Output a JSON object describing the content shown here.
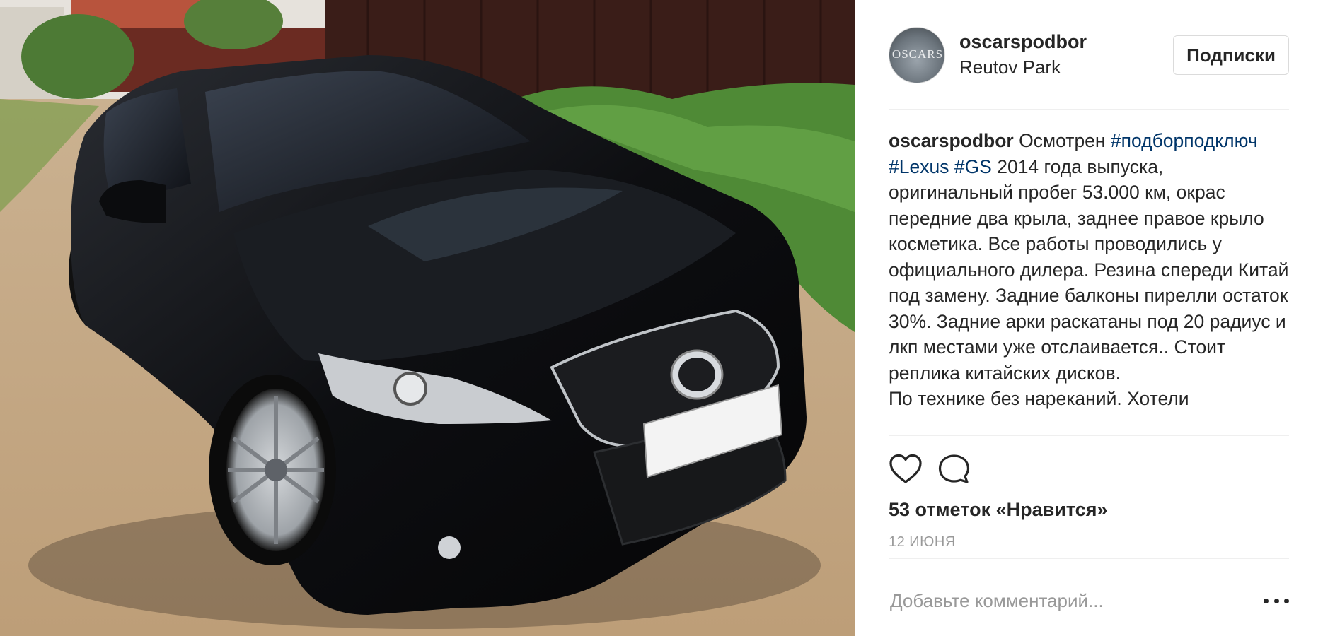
{
  "post": {
    "photo_subject": "black-sedan-photo",
    "author": {
      "username": "oscarspodbor",
      "avatar_text": "OSCARS",
      "location": "Reutov Park"
    },
    "follow_button_label": "Подписки",
    "caption": {
      "username": "oscarspodbor",
      "text_before": " Осмотрен ",
      "hashtags": [
        "#подборподключ",
        "#Lexus",
        "#GS"
      ],
      "text_after": " 2014 года выпуска, оригинальный пробег 53.000 км, окрас передние два крыла, заднее правое крыло косметика. Все работы проводились у официального дилера. Резина спереди Китай под замену. Задние балконы пирелли остаток 30%. Задние арки раскатаны под 20 радиус и лкп местами уже отслаивается.. Стоит реплика китайских дисков.\nПо технике без нареканий. Хотели"
    },
    "actions": {
      "like_icon": "heart-icon",
      "comment_icon": "comment-bubble-icon"
    },
    "likes_text": "53 отметок «Нравится»",
    "date_text": "12 ИЮНЯ",
    "comment_box": {
      "placeholder": "Добавьте комментарий...",
      "more_icon": "ellipsis-icon"
    }
  },
  "colors": {
    "text": "#262626",
    "hashtag": "#003569",
    "muted": "#999999",
    "border": "#dbdbdb"
  }
}
